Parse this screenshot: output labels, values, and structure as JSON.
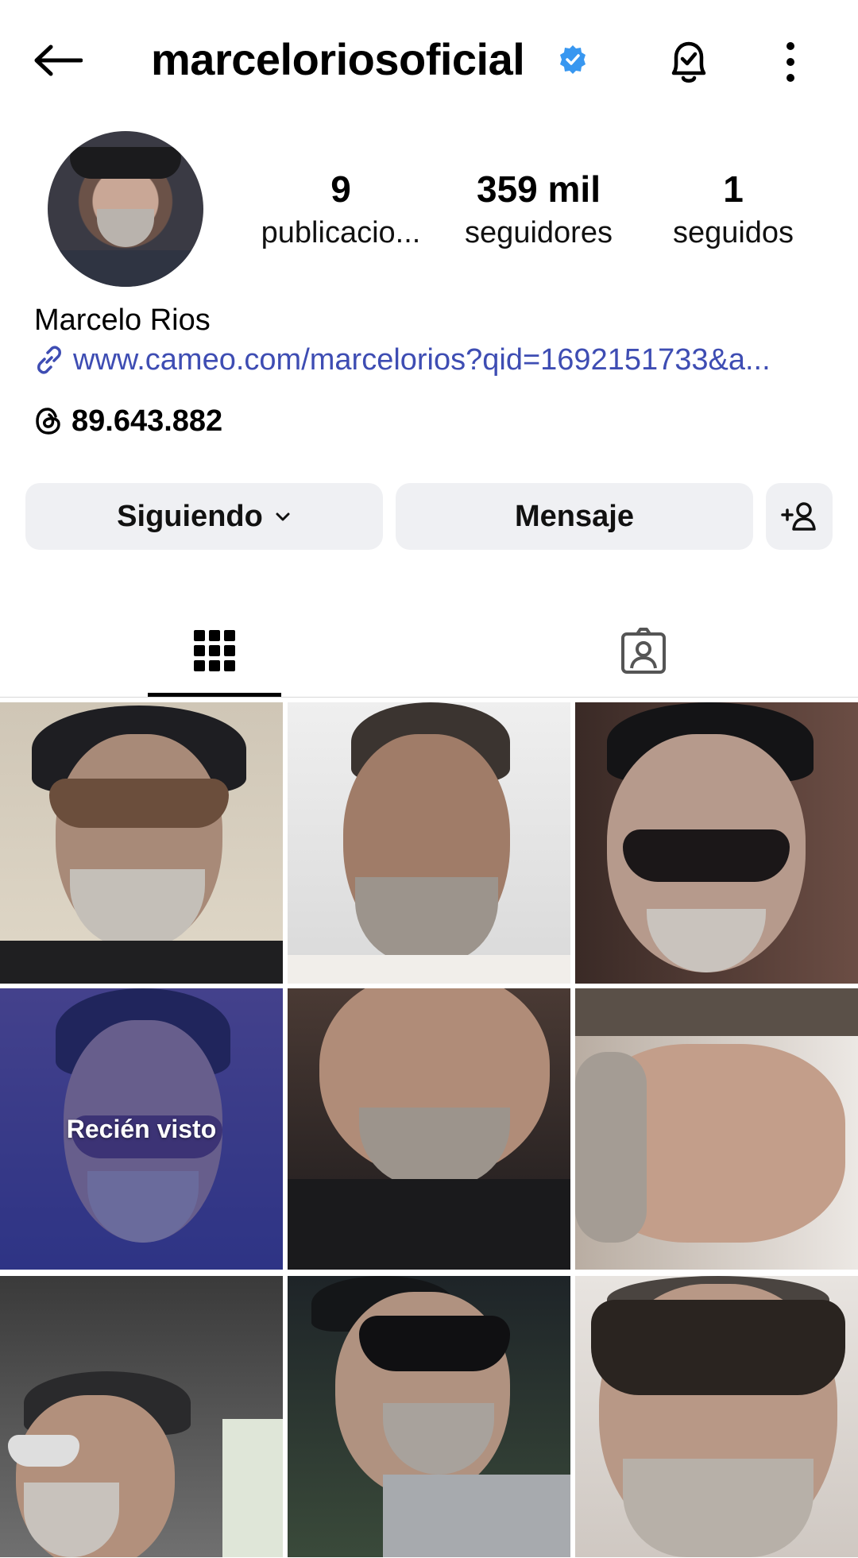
{
  "header": {
    "username": "marceloriosoficial",
    "verified": true,
    "accent_color": "#3897f0"
  },
  "profile": {
    "stats": [
      {
        "value": "9",
        "label": "publicacio..."
      },
      {
        "value": "359 mil",
        "label": "seguidores"
      },
      {
        "value": "1",
        "label": "seguidos"
      }
    ],
    "full_name": "Marcelo Rios",
    "link": "www.cameo.com/marcelorios?qid=1692151733&a...",
    "link_color": "#3e4db3",
    "threads_count": "89.643.882"
  },
  "actions": {
    "following_label": "Siguiendo",
    "message_label": "Mensaje"
  },
  "tabs": [
    {
      "name": "grid-icon",
      "active": true
    },
    {
      "name": "tagged-icon",
      "active": false
    }
  ],
  "posts": {
    "recently_viewed_label": "Recién visto"
  }
}
